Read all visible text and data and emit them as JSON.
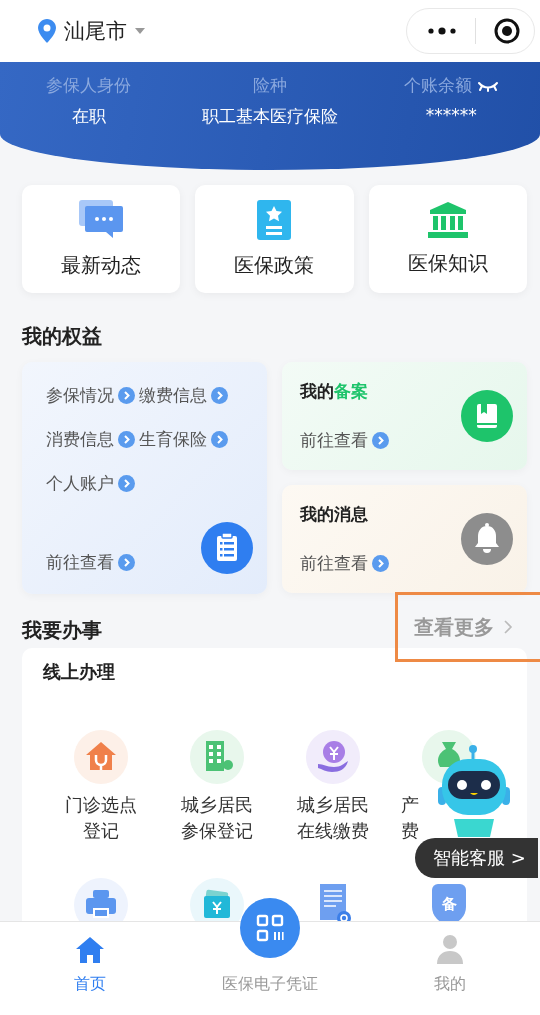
{
  "header": {
    "city": "汕尾市"
  },
  "summary": [
    {
      "label": "参保人身份",
      "value": "在职"
    },
    {
      "label": "险种",
      "value": "职工基本医疗保险"
    },
    {
      "label": "个账余额",
      "value": "******",
      "kind": "balance"
    }
  ],
  "quick_links": [
    {
      "label": "最新动态",
      "kind": "chat"
    },
    {
      "label": "医保政策",
      "kind": "policy"
    },
    {
      "label": "医保知识",
      "kind": "bank"
    }
  ],
  "benefits": {
    "title": "我的权益",
    "links": [
      "参保情况",
      "缴费信息",
      "消费信息",
      "生育保险",
      "个人账户"
    ],
    "action": "前往查看",
    "filing": {
      "title": "我的",
      "accent": "备案",
      "action": "前往查看"
    },
    "messages": {
      "title": "我的消息",
      "action": "前往查看"
    }
  },
  "tasks": {
    "title": "我要办事",
    "more": "查看更多",
    "more_highlighted": true,
    "panel_title": "线上办理",
    "services": [
      {
        "kind": "clinic",
        "lines": [
          "门诊选点",
          "登记"
        ]
      },
      {
        "kind": "building",
        "lines": [
          "城乡居民",
          "参保登记"
        ]
      },
      {
        "kind": "coin",
        "lines": [
          "城乡居民",
          "在线缴费"
        ]
      },
      {
        "kind": "moneybag",
        "lines": [
          "产",
          "费"
        ]
      },
      {
        "kind": "printer"
      },
      {
        "kind": "wallet"
      },
      {
        "kind": "document"
      },
      {
        "kind": "shield",
        "mark": "备"
      }
    ]
  },
  "assistant": {
    "label": "智能客服 >"
  },
  "nav": [
    {
      "label": "首页",
      "kind": "home",
      "selected": true
    },
    {
      "label": "医保电子凭证",
      "kind": "qr",
      "selected": false
    },
    {
      "label": "我的",
      "kind": "person",
      "selected": false
    }
  ]
}
